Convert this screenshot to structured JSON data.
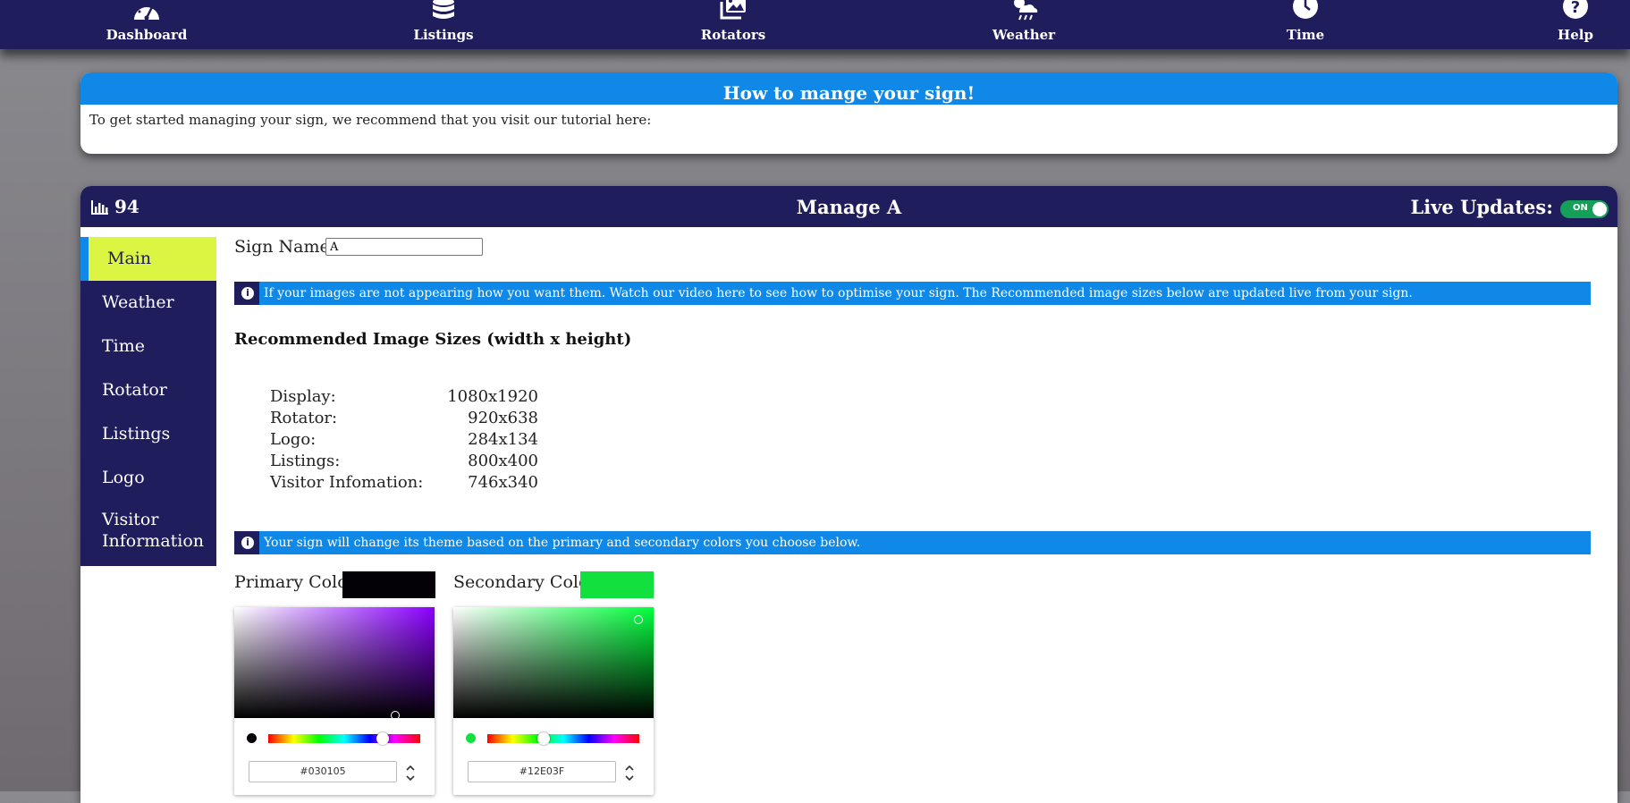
{
  "nav": {
    "items": [
      {
        "label": "Dashboard",
        "icon": "gauge-icon"
      },
      {
        "label": "Listings",
        "icon": "database-icon"
      },
      {
        "label": "Rotators",
        "icon": "images-icon"
      },
      {
        "label": "Weather",
        "icon": "cloud-sun-rain-icon"
      },
      {
        "label": "Time",
        "icon": "clock-icon"
      },
      {
        "label": "Help",
        "icon": "question-circle-icon"
      }
    ]
  },
  "info": {
    "title": "How to mange your sign!",
    "body": "To get started managing your sign, we recommend that you visit our tutorial here:"
  },
  "manage": {
    "stat_value": "94",
    "stat_icon": "bar-chart-icon",
    "title": "Manage A",
    "live_label": "Live Updates:",
    "live_toggle": "ON"
  },
  "sidebar": {
    "items": [
      {
        "label": "Main",
        "active": true
      },
      {
        "label": "Weather"
      },
      {
        "label": "Time"
      },
      {
        "label": "Rotator"
      },
      {
        "label": "Listings"
      },
      {
        "label": "Logo"
      },
      {
        "label": "Visitor Information"
      }
    ]
  },
  "main": {
    "sign_name_label": "Sign Name:",
    "sign_name_value": "A",
    "alert_images": "If your images are not appearing how you want them. Watch our video here to see how to optimise your sign. The Recommended image sizes below are updated live from your sign.",
    "sizes_title": "Recommended Image Sizes (width x height)",
    "sizes": [
      {
        "label": "Display:",
        "value": "1080x1920"
      },
      {
        "label": "Rotator:",
        "value": "920x638"
      },
      {
        "label": "Logo:",
        "value": "284x134"
      },
      {
        "label": "Listings:",
        "value": "800x400"
      },
      {
        "label": "Visitor Infomation:",
        "value": "746x340"
      }
    ],
    "alert_theme": "Your sign will change its theme based on the primary and secondary colors you choose below.",
    "primary": {
      "label": "Primary Color:",
      "hex": "#030105",
      "hue_color": "#8a00ff"
    },
    "secondary": {
      "label": "Secondary Color:",
      "hex": "#12E03F",
      "hue_color": "#00ff3c"
    }
  },
  "colors": {
    "navy": "#1f1d5c",
    "blue": "#0f88e8",
    "lime": "#dcf542"
  }
}
